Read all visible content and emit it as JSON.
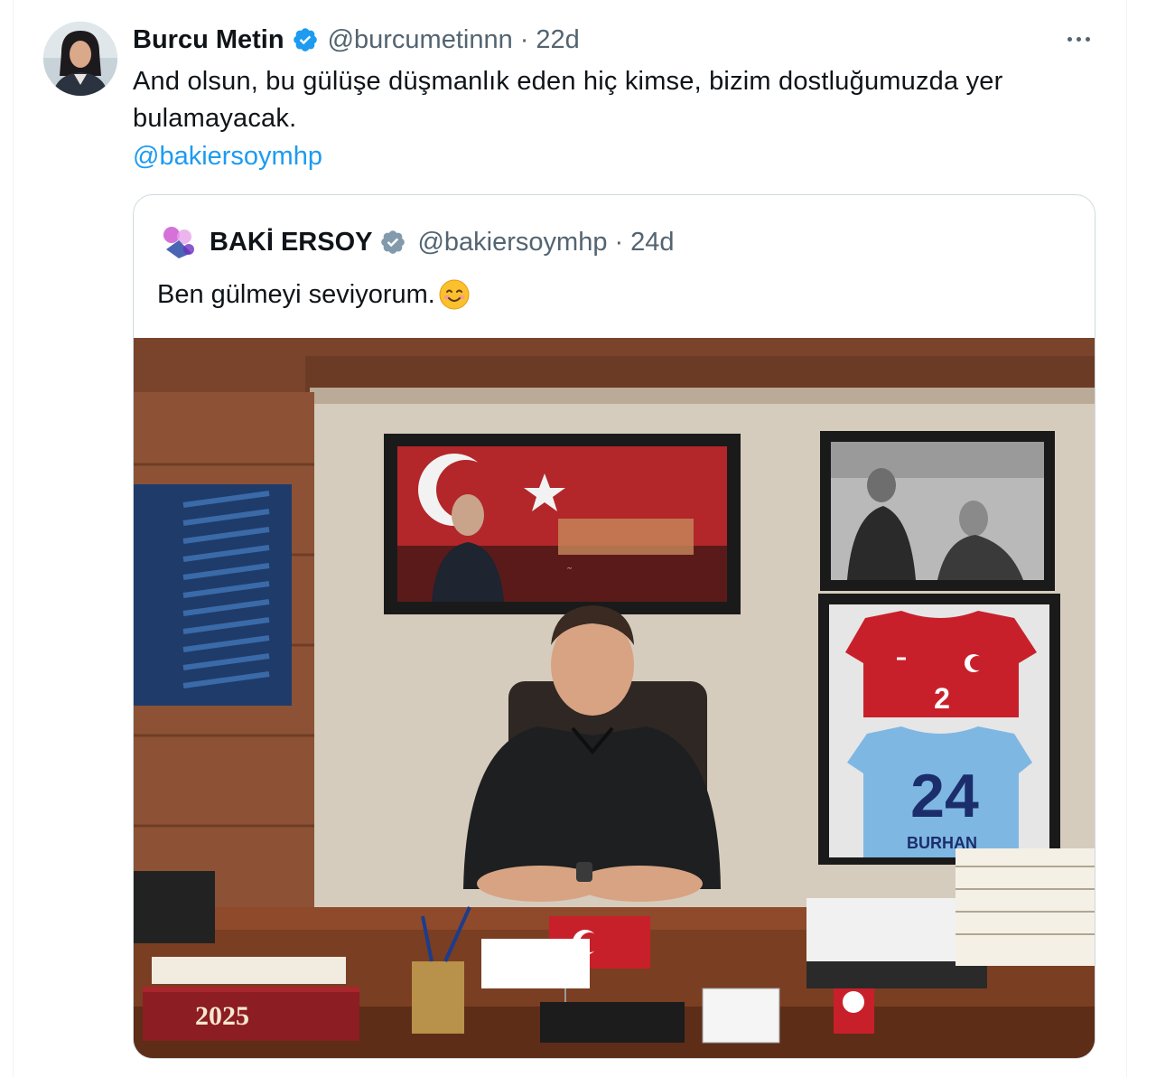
{
  "tweet": {
    "author_name": "Burcu Metin",
    "handle": "@burcumetinnn",
    "separator": "·",
    "time": "22d",
    "text": "And olsun, bu gülüşe düşmanlık eden hiç kimse, bizim dostluğumuzda yer bulamayacak.",
    "mention": "@bakiersoymhp",
    "avatar_icon": "profile-photo",
    "verified_icon": "verified-badge-icon",
    "more_icon": "more-options-icon"
  },
  "quote": {
    "author_name": "BAKİ ERSOY",
    "handle": "@bakiersoymhp",
    "separator": "·",
    "time": "24d",
    "text": "Ben gülmeyi seviyorum.",
    "emoji_icon": "smiling-face-emoji-icon",
    "media": {
      "calendar_year": "2025",
      "jersey_number_red": "2",
      "jersey_number_blue": "24",
      "jersey_name": "BURHAN"
    }
  },
  "colors": {
    "link": "#1d9bf0",
    "secondary_text": "#536471",
    "primary_text": "#0f1419",
    "verified": "#1d9bf0",
    "border": "#cfd9de"
  }
}
